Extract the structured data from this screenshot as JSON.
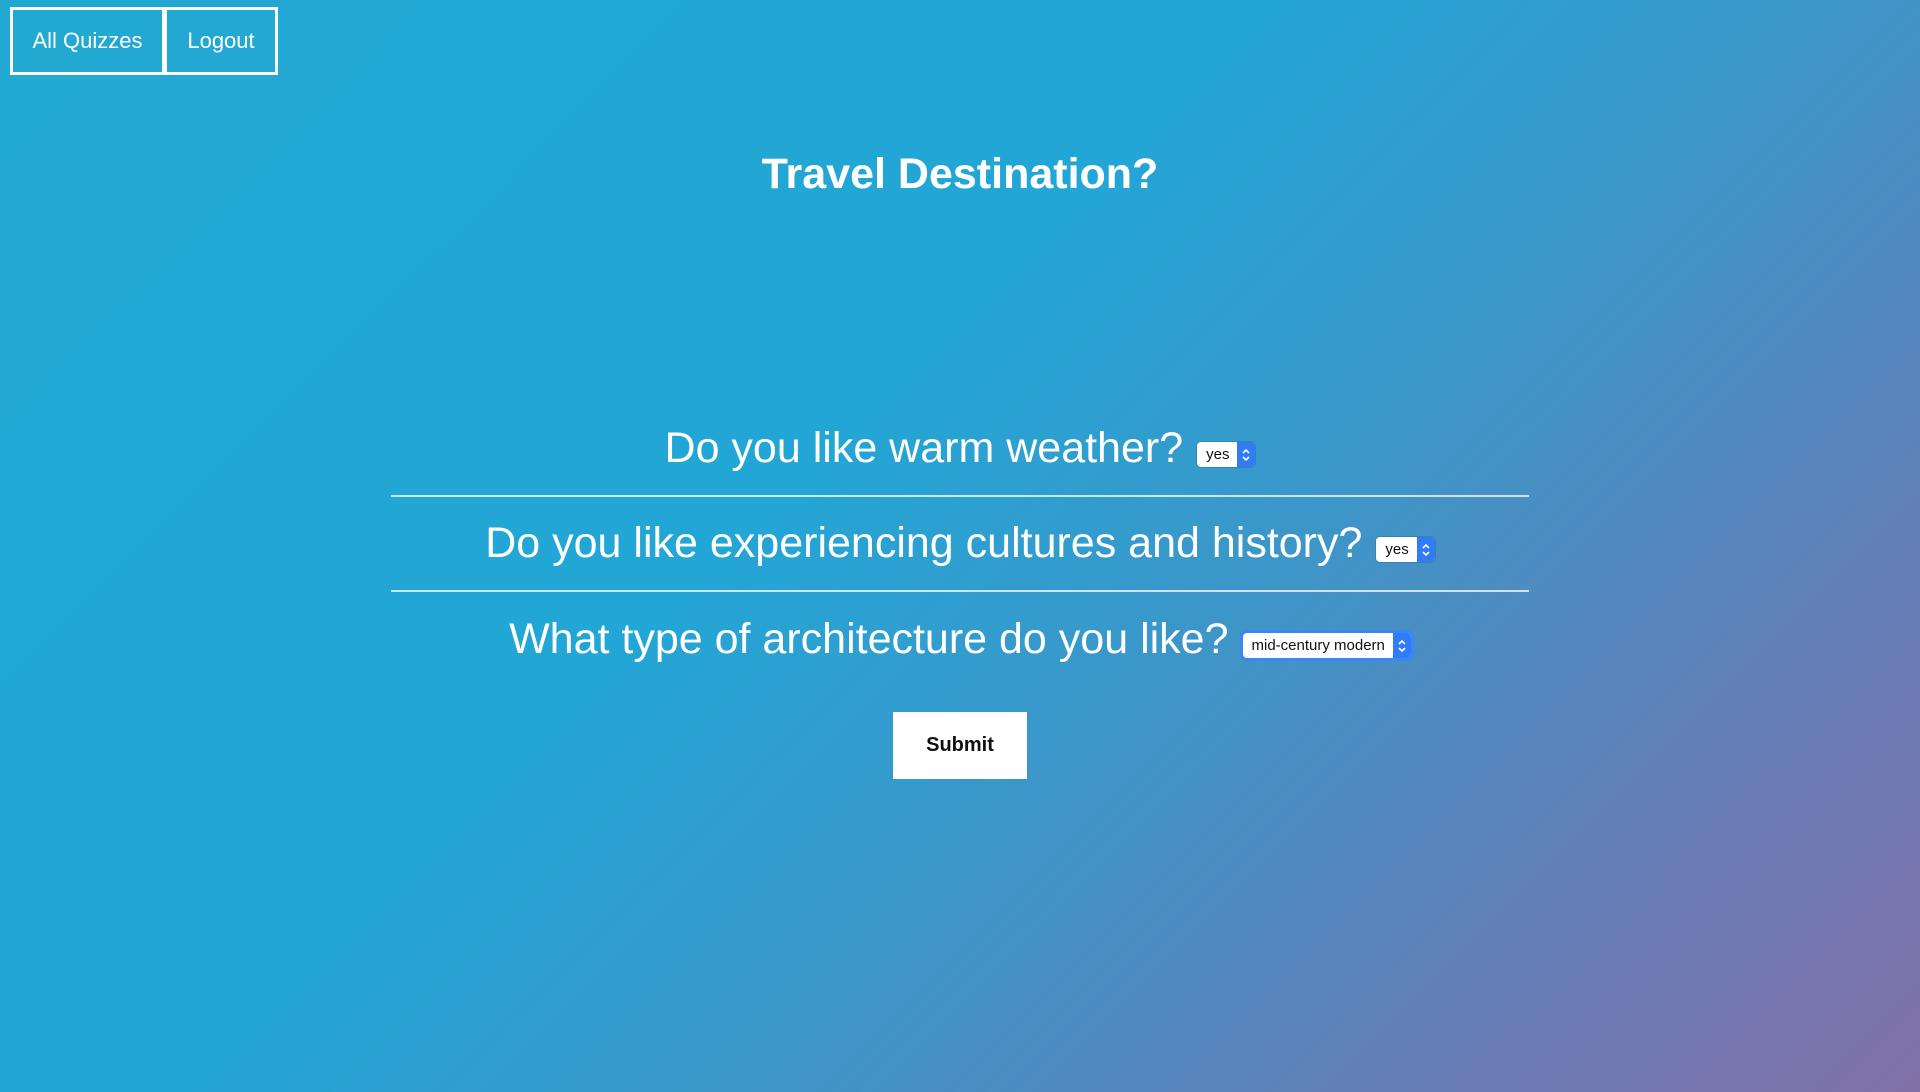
{
  "nav": {
    "all_quizzes_label": "All Quizzes",
    "logout_label": "Logout"
  },
  "quiz": {
    "title": "Travel Destination?",
    "questions": [
      {
        "text": "Do you like warm weather?",
        "selected": "yes"
      },
      {
        "text": "Do you like experiencing cultures and history?",
        "selected": "yes"
      },
      {
        "text": "What type of architecture do you like?",
        "selected": "mid-century modern"
      }
    ],
    "submit_label": "Submit"
  },
  "colors": {
    "gradient_start": "#22a9d2",
    "gradient_end": "#8170a8",
    "select_accent": "#2f7cf6"
  },
  "icons": {
    "select_arrows": "chevron-up-down-icon"
  }
}
